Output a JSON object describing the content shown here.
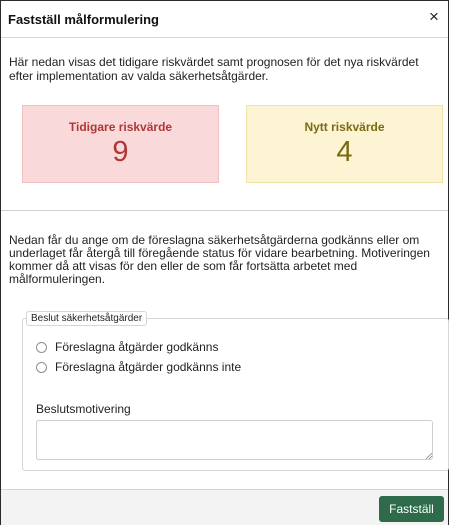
{
  "dialog": {
    "title": "Fastställ målformulering",
    "close_glyph": "×"
  },
  "intro_text": "Här nedan visas det tidigare riskvärdet samt prognosen för det nya riskvärdet efter implementation av valda säkerhetsåtgärder.",
  "risk": {
    "previous": {
      "label": "Tidigare riskvärde",
      "value": "9"
    },
    "new": {
      "label": "Nytt riskvärde",
      "value": "4"
    }
  },
  "description_text": "Nedan får du ange om de föreslagna säkerhetsåtgärderna godkänns eller om underlaget får återgå till föregående status för vidare bearbetning. Motiveringen kommer då att visas för den eller de som får fortsätta arbetet med målformuleringen.",
  "decision": {
    "legend": "Beslut säkerhetsåtgärder",
    "options": [
      "Föreslagna åtgärder godkänns",
      "Föreslagna åtgärder godkänns inte"
    ],
    "selected": null
  },
  "motivation": {
    "label": "Beslutsmotivering",
    "value": ""
  },
  "footer": {
    "submit_label": "Fastställ"
  },
  "colors": {
    "previous_bg": "#f9d9d9",
    "previous_fg": "#b03737",
    "new_bg": "#fcf4d2",
    "new_fg": "#7a6a12",
    "primary_button": "#2e6b4a"
  },
  "icons": {
    "close": "close-icon",
    "resize": "resize-grip-icon"
  }
}
